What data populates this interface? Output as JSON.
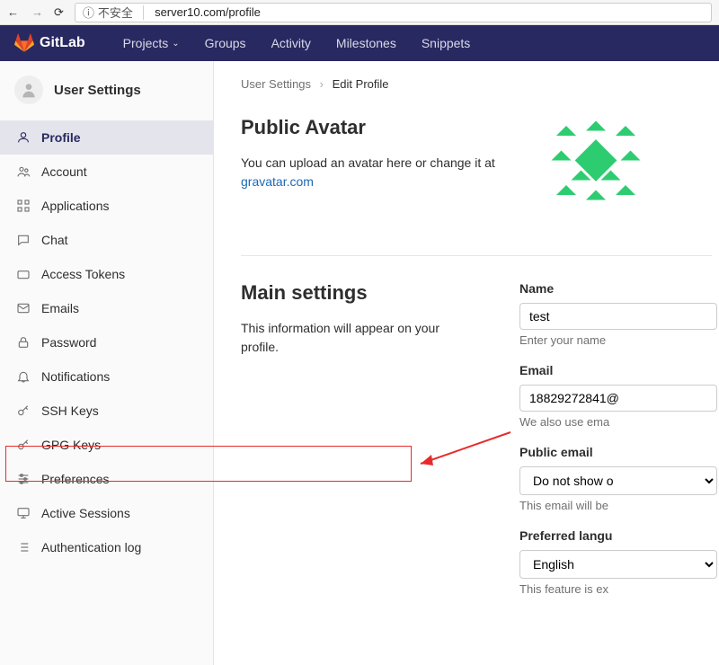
{
  "browser": {
    "security": "不安全",
    "url": "server10.com/profile"
  },
  "brand": "GitLab",
  "topnav": {
    "projects": "Projects",
    "groups": "Groups",
    "activity": "Activity",
    "milestones": "Milestones",
    "snippets": "Snippets"
  },
  "sidebar": {
    "title": "User Settings",
    "items": [
      {
        "label": "Profile"
      },
      {
        "label": "Account"
      },
      {
        "label": "Applications"
      },
      {
        "label": "Chat"
      },
      {
        "label": "Access Tokens"
      },
      {
        "label": "Emails"
      },
      {
        "label": "Password"
      },
      {
        "label": "Notifications"
      },
      {
        "label": "SSH Keys"
      },
      {
        "label": "GPG Keys"
      },
      {
        "label": "Preferences"
      },
      {
        "label": "Active Sessions"
      },
      {
        "label": "Authentication log"
      }
    ]
  },
  "breadcrumb": {
    "parent": "User Settings",
    "current": "Edit Profile"
  },
  "avatar_section": {
    "title": "Public Avatar",
    "desc_prefix": "You can upload an avatar here or change it at ",
    "link": "gravatar.com"
  },
  "main_settings": {
    "title": "Main settings",
    "desc": "This information will appear on your profile."
  },
  "form": {
    "name_label": "Name",
    "name_value": "test",
    "name_hint": "Enter your name",
    "email_label": "Email",
    "email_value": "18829272841@",
    "email_hint": "We also use ema",
    "public_email_label": "Public email",
    "public_email_value": "Do not show o",
    "public_email_hint": "This email will be",
    "lang_label": "Preferred langu",
    "lang_value": "English",
    "lang_hint": "This feature is ex"
  }
}
